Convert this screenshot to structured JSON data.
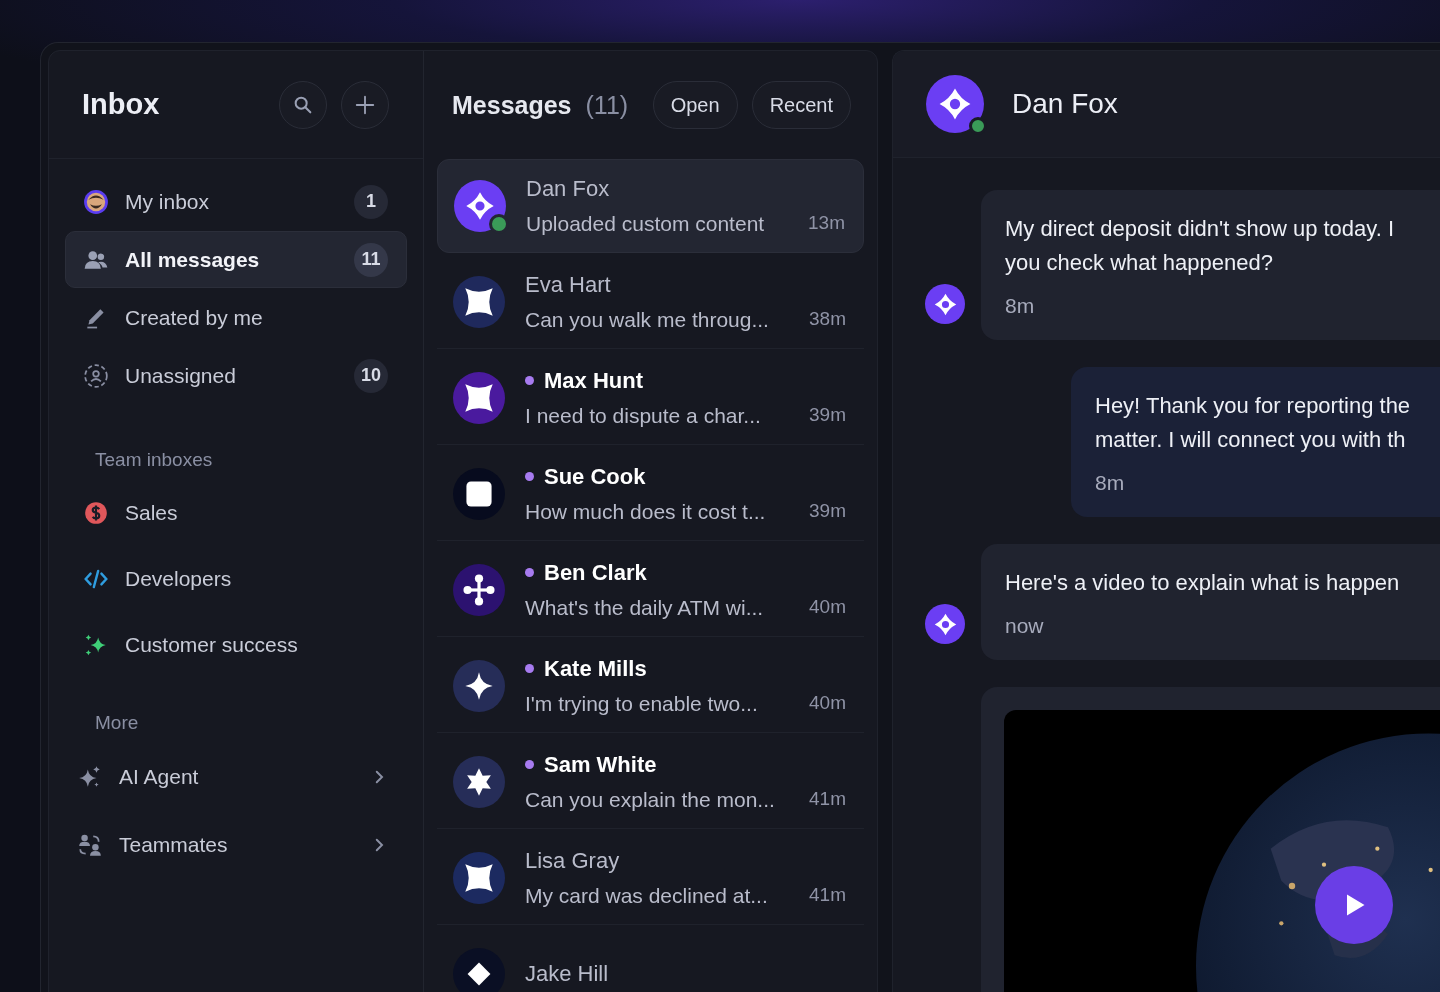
{
  "sidebar": {
    "title": "Inbox",
    "nav": [
      {
        "label": "My inbox",
        "count": "1",
        "selected": false
      },
      {
        "label": "All messages",
        "count": "11",
        "selected": true
      },
      {
        "label": "Created by me",
        "selected": false
      },
      {
        "label": "Unassigned",
        "count": "10",
        "selected": false
      }
    ],
    "sections": [
      {
        "title": "Team inboxes",
        "items": [
          {
            "kind": "team",
            "label": "Sales",
            "selected": false
          },
          {
            "kind": "team",
            "label": "Developers",
            "selected": false
          },
          {
            "kind": "team",
            "label": "Customer success",
            "selected": false
          }
        ]
      },
      {
        "title": "More",
        "items": [
          {
            "kind": "submenu",
            "label": "AI Agent",
            "selected": false
          },
          {
            "kind": "submenu",
            "label": "Teammates",
            "selected": false
          }
        ]
      }
    ]
  },
  "messages": {
    "title": "Messages",
    "count": "(11)",
    "filters": [
      "Open",
      "Recent"
    ],
    "items": [
      {
        "name": "Dan Fox",
        "preview": "Uploaded custom content",
        "time": "13m",
        "unread": false,
        "online": true,
        "selected": true,
        "color": "#6b3ef3"
      },
      {
        "name": "Eva Hart",
        "preview": "Can you walk me throug...",
        "time": "38m",
        "unread": false,
        "online": false,
        "selected": false,
        "color": "#1f295c"
      },
      {
        "name": "Max Hunt",
        "preview": "I need to dispute a char...",
        "time": "39m",
        "unread": true,
        "online": false,
        "selected": false,
        "color": "#4a1a9e"
      },
      {
        "name": "Sue Cook",
        "preview": "How much does it cost t...",
        "time": "39m",
        "unread": true,
        "online": false,
        "selected": false,
        "color": "#070b1e"
      },
      {
        "name": "Ben Clark",
        "preview": "What's the daily ATM wi...",
        "time": "40m",
        "unread": true,
        "online": false,
        "selected": false,
        "color": "#2c1270"
      },
      {
        "name": "Kate Mills",
        "preview": "I'm trying to enable two...",
        "time": "40m",
        "unread": true,
        "online": false,
        "selected": false,
        "color": "#262d58"
      },
      {
        "name": "Sam White",
        "preview": "Can you explain the mon...",
        "time": "41m",
        "unread": true,
        "online": false,
        "selected": false,
        "color": "#262d58"
      },
      {
        "name": "Lisa Gray",
        "preview": "My card was declined at...",
        "time": "41m",
        "unread": false,
        "online": false,
        "selected": false,
        "color": "#1c2a60"
      },
      {
        "name": "Jake Hill",
        "unread": false,
        "online": false,
        "selected": false,
        "color": "#0a0f24"
      }
    ]
  },
  "conversation": {
    "name": "Dan Fox",
    "online": true,
    "messages": [
      {
        "kind": "incoming",
        "lines": [
          "My direct deposit didn't show up today. I",
          "you check what happened?"
        ],
        "time": "8m"
      },
      {
        "kind": "outgoing",
        "lines": [
          "Hey! Thank you for reporting the",
          "matter. I will connect you with th"
        ],
        "time": "8m"
      },
      {
        "kind": "incoming",
        "lines": [
          "Here's a video to explain what is happen"
        ],
        "time": "now"
      },
      {
        "kind": "video"
      }
    ]
  }
}
